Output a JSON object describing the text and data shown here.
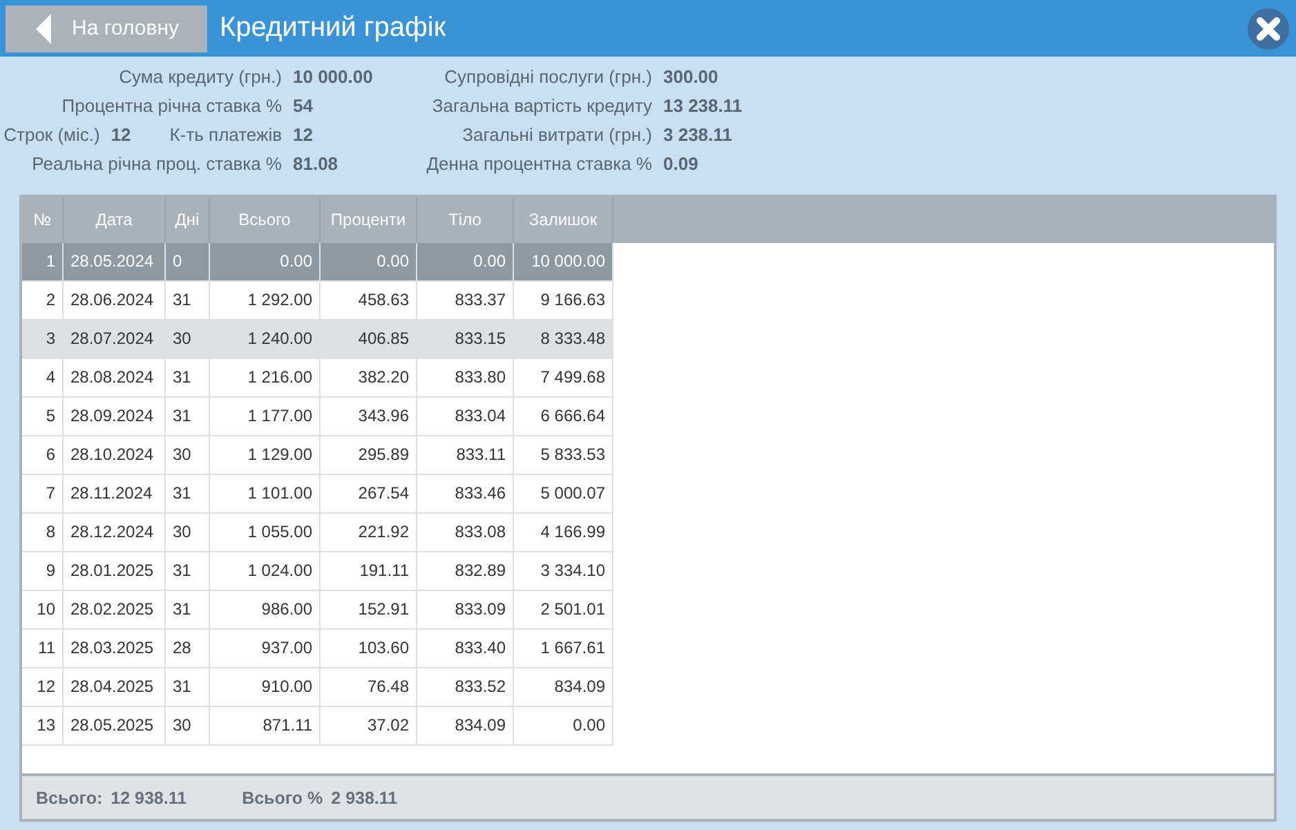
{
  "header": {
    "back_button": "На головну",
    "title": "Кредитний графік"
  },
  "summary_left": [
    {
      "items": [
        {
          "label": "Сума кредиту (грн.)",
          "value": "10 000.00"
        }
      ]
    },
    {
      "items": [
        {
          "label": "Процентна річна ставка %",
          "value": "54"
        }
      ]
    },
    {
      "items": [
        {
          "label": "Строк (міс.)",
          "value": "12"
        },
        {
          "label": "К-ть платежів",
          "value": "12"
        }
      ]
    },
    {
      "items": [
        {
          "label": "Реальна річна проц. ставка %",
          "value": "81.08"
        }
      ]
    }
  ],
  "summary_right": [
    {
      "label": "Супровідні послуги (грн.)",
      "value": "300.00"
    },
    {
      "label": "Загальна вартість кредиту",
      "value": "13 238.11"
    },
    {
      "label": "Загальні витрати (грн.)",
      "value": "3 238.11"
    },
    {
      "label": "Денна процентна ставка %",
      "value": "0.09"
    }
  ],
  "table": {
    "columns": [
      "№",
      "Дата",
      "Дні",
      "Всього",
      "Проценти",
      "Тіло",
      "Залишок"
    ],
    "rows": [
      {
        "selected": true,
        "highlighted": false,
        "cells": [
          "1",
          "28.05.2024",
          "0",
          "0.00",
          "0.00",
          "0.00",
          "10 000.00"
        ]
      },
      {
        "selected": false,
        "highlighted": false,
        "cells": [
          "2",
          "28.06.2024",
          "31",
          "1 292.00",
          "458.63",
          "833.37",
          "9 166.63"
        ]
      },
      {
        "selected": false,
        "highlighted": true,
        "cells": [
          "3",
          "28.07.2024",
          "30",
          "1 240.00",
          "406.85",
          "833.15",
          "8 333.48"
        ]
      },
      {
        "selected": false,
        "highlighted": false,
        "cells": [
          "4",
          "28.08.2024",
          "31",
          "1 216.00",
          "382.20",
          "833.80",
          "7 499.68"
        ]
      },
      {
        "selected": false,
        "highlighted": false,
        "cells": [
          "5",
          "28.09.2024",
          "31",
          "1 177.00",
          "343.96",
          "833.04",
          "6 666.64"
        ]
      },
      {
        "selected": false,
        "highlighted": false,
        "cells": [
          "6",
          "28.10.2024",
          "30",
          "1 129.00",
          "295.89",
          "833.11",
          "5 833.53"
        ]
      },
      {
        "selected": false,
        "highlighted": false,
        "cells": [
          "7",
          "28.11.2024",
          "31",
          "1 101.00",
          "267.54",
          "833.46",
          "5 000.07"
        ]
      },
      {
        "selected": false,
        "highlighted": false,
        "cells": [
          "8",
          "28.12.2024",
          "30",
          "1 055.00",
          "221.92",
          "833.08",
          "4 166.99"
        ]
      },
      {
        "selected": false,
        "highlighted": false,
        "cells": [
          "9",
          "28.01.2025",
          "31",
          "1 024.00",
          "191.11",
          "832.89",
          "3 334.10"
        ]
      },
      {
        "selected": false,
        "highlighted": false,
        "cells": [
          "10",
          "28.02.2025",
          "31",
          "986.00",
          "152.91",
          "833.09",
          "2 501.01"
        ]
      },
      {
        "selected": false,
        "highlighted": false,
        "cells": [
          "11",
          "28.03.2025",
          "28",
          "937.00",
          "103.60",
          "833.40",
          "1 667.61"
        ]
      },
      {
        "selected": false,
        "highlighted": false,
        "cells": [
          "12",
          "28.04.2025",
          "31",
          "910.00",
          "76.48",
          "833.52",
          "834.09"
        ]
      },
      {
        "selected": false,
        "highlighted": false,
        "cells": [
          "13",
          "28.05.2025",
          "30",
          "871.11",
          "37.02",
          "834.09",
          "0.00"
        ]
      }
    ]
  },
  "footer": [
    {
      "label": "Всього:",
      "value": "12 938.11"
    },
    {
      "label": "Всього %",
      "value": "2 938.11"
    }
  ]
}
